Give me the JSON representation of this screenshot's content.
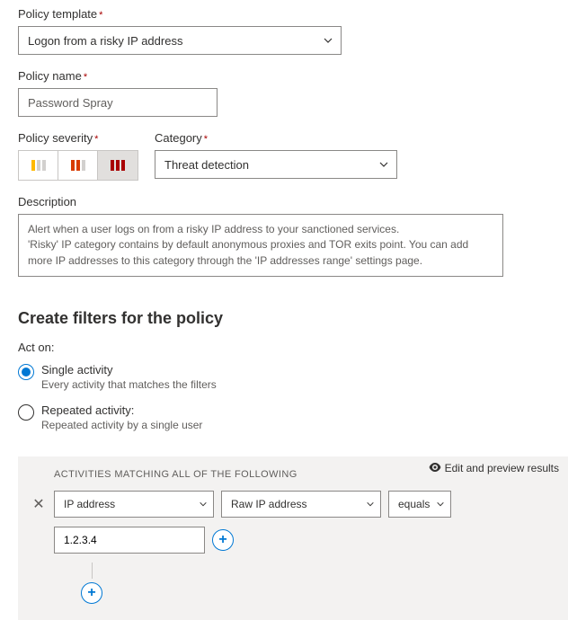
{
  "policy_template": {
    "label": "Policy template",
    "value": "Logon from a risky IP address"
  },
  "policy_name": {
    "label": "Policy name",
    "value": "Password Spray"
  },
  "policy_severity": {
    "label": "Policy severity"
  },
  "category": {
    "label": "Category",
    "value": "Threat detection"
  },
  "description": {
    "label": "Description",
    "text": "Alert when a user logs on from a risky IP address to your sanctioned services.\n'Risky' IP category contains by default anonymous proxies and TOR exits point. You can add more IP addresses to this category through the 'IP addresses range' settings page."
  },
  "filters_section": {
    "title": "Create filters for the policy",
    "act_on_label": "Act on:",
    "options": [
      {
        "primary": "Single activity",
        "secondary": "Every activity that matches the filters",
        "checked": true
      },
      {
        "primary": "Repeated activity:",
        "secondary": "Repeated activity by a single user",
        "checked": false
      }
    ],
    "panel_header": "ACTIVITIES MATCHING ALL OF THE FOLLOWING",
    "preview_link": "Edit and preview results",
    "row": {
      "field": "IP address",
      "subfield": "Raw IP address",
      "operator": "equals",
      "value": "1.2.3.4"
    }
  }
}
